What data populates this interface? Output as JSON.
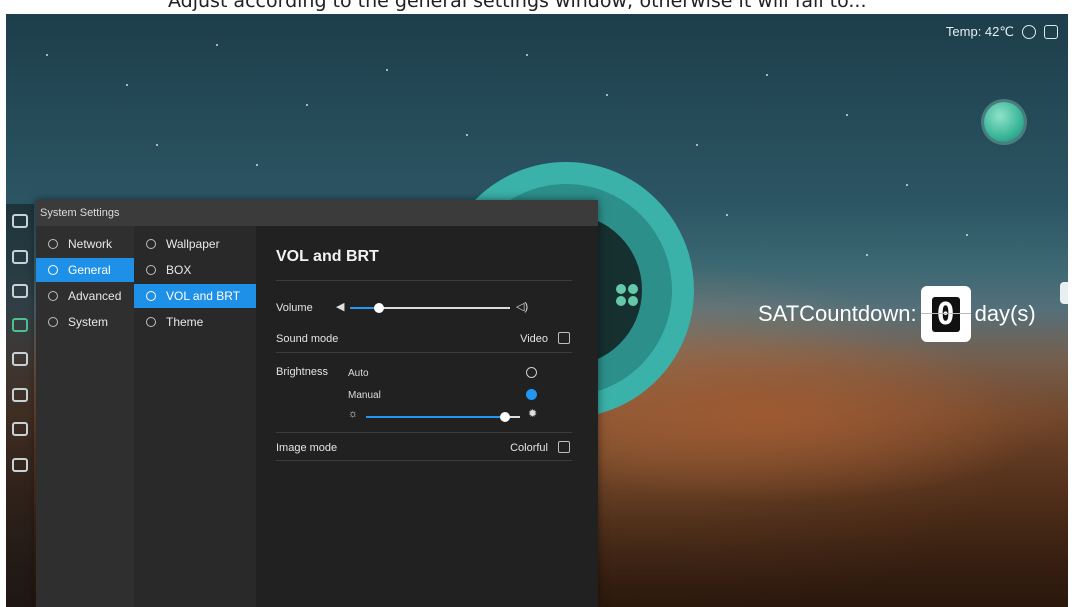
{
  "top_caption": "Adjust according to the general settings window; otherwise it will fail to...",
  "status_bar": {
    "temperature": "Temp: 42℃",
    "icons": [
      "wireless-icon",
      "message-icon"
    ]
  },
  "countdown": {
    "label": "SATCountdown:",
    "digit": "0",
    "unit": "day(s)"
  },
  "settings": {
    "title": "System Settings",
    "categories": [
      {
        "label": "Network",
        "icon": "globe-icon",
        "active": false
      },
      {
        "label": "General",
        "icon": "general-icon",
        "active": true
      },
      {
        "label": "Advanced",
        "icon": "tools-icon",
        "active": false
      },
      {
        "label": "System",
        "icon": "system-icon",
        "active": false
      }
    ],
    "subcategories": [
      {
        "label": "Wallpaper",
        "icon": "wallpaper-icon",
        "active": false
      },
      {
        "label": "BOX",
        "icon": "box-icon",
        "active": false
      },
      {
        "label": "VOL and BRT",
        "icon": "sliders-icon",
        "active": true
      },
      {
        "label": "Theme",
        "icon": "theme-icon",
        "active": false
      }
    ],
    "page": {
      "title": "VOL and BRT",
      "volume_label": "Volume",
      "volume_level": 0.18,
      "sound_mode_label": "Sound mode",
      "sound_mode_value": "Video",
      "brightness_label": "Brightness",
      "brightness_auto": "Auto",
      "brightness_manual": "Manual",
      "brightness_selected": "Manual",
      "brightness_level": 0.9,
      "image_mode_label": "Image mode",
      "image_mode_value": "Colorful"
    }
  },
  "colors": {
    "accent": "#1e90e8",
    "panel": "#2b2b2b"
  }
}
